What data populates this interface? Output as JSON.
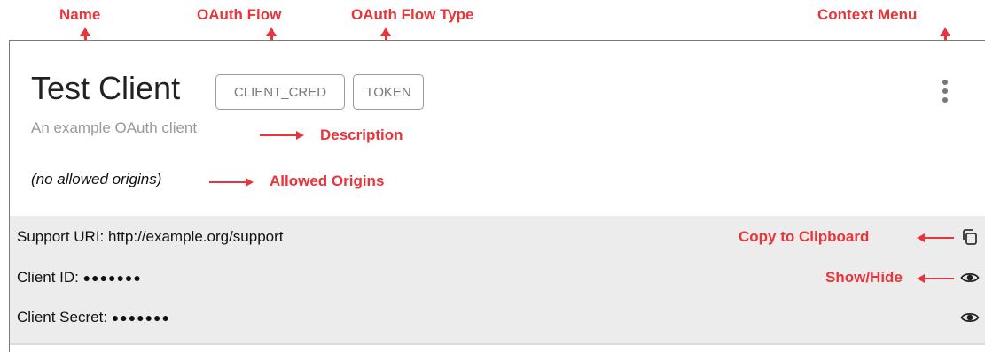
{
  "annotations": {
    "name": "Name",
    "oauth_flow": "OAuth Flow",
    "oauth_flow_type": "OAuth Flow Type",
    "context_menu": "Context Menu",
    "description": "Description",
    "allowed_origins": "Allowed Origins",
    "copy_to_clipboard": "Copy to Clipboard",
    "show_hide": "Show/Hide"
  },
  "client": {
    "name": "Test Client",
    "flow": "CLIENT_CRED",
    "flow_type": "TOKEN",
    "description": "An example OAuth client",
    "allowed_origins": "(no allowed origins)"
  },
  "details": {
    "support_uri_label": "Support URI:",
    "support_uri_value": "http://example.org/support",
    "client_id_label": "Client ID:",
    "client_id_value": "●●●●●●●",
    "client_secret_label": "Client Secret:",
    "client_secret_value": "●●●●●●●"
  },
  "icons": {
    "menu": "kebab-vertical-icon",
    "copy": "copy-icon",
    "show_hide": "eye-icon"
  },
  "colors": {
    "annotation": "#e8343a",
    "detail_background": "#ececec"
  }
}
